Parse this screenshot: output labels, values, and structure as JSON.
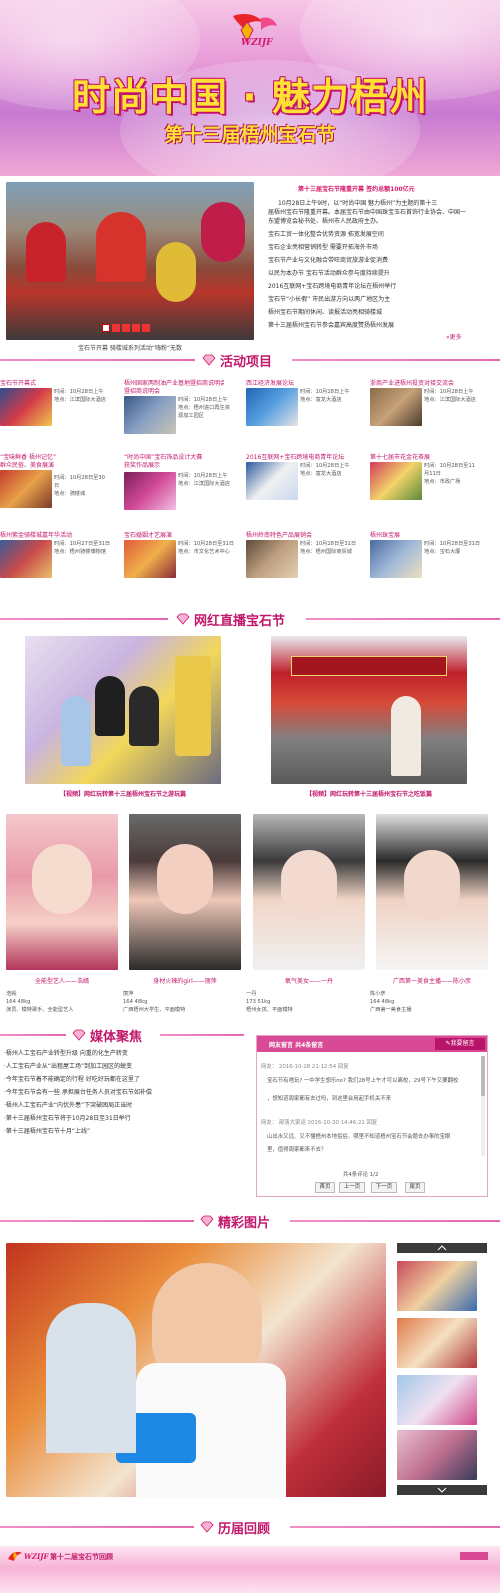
{
  "banner": {
    "logo_text": "WZIJF",
    "title": "时尚中国 · 魅力梧州",
    "subtitle": "第十三届梧州宝石节"
  },
  "top_news": {
    "photo_caption": "宝石节开幕 骑楼城系列活动“嗨粉”无数",
    "headline": "第十三届宝石节隆重开幕 签约总额100亿元",
    "summary": [
      "10月28日上午9时，以“时尚中国 魅力梧州”为主题的第十三",
      "届梧州宝石节隆重开幕。本届宝石节由中国珠宝玉石首饰行业协会、中国一",
      "东盟博览会秘书处、梧州市人民政府主办。"
    ],
    "list": [
      "宝石工贸一体化整合优势资源 拓宽发展空间",
      "宝石企业亮相营销转型 需要开拓海外市场",
      "宝石节产业与文化融合带旺商贸旅游业促消费",
      "以民为本办节 宝石节活动群众参与度持续提升",
      "2016互联网+宝石跨境电商青年论坛在梧州举行",
      "宝石节“小长假” 市民出游方向以两广地区为主",
      "梧州宝石节期间休闲、读报活动亮相骑楼城",
      "第十三届梧州宝石节参会嘉宾高度赞扬梧州发展"
    ],
    "more": "更多"
  },
  "sections": {
    "activities": "活动项目",
    "live": "网红直播宝石节",
    "media": "媒体聚焦",
    "photos": "精彩图片",
    "review": "历届回顾"
  },
  "activities": [
    {
      "title": "宝石节开幕式",
      "time": "时间：10月28日上午",
      "place": "地点：江滨国际大酒店"
    },
    {
      "title": "梧州国家两制油产业基地暨招商说明会",
      "time": "时间：10月28日上午",
      "place": "地点：梧州进口再生资源加工园区"
    },
    {
      "title": "西江经济发展论坛",
      "time": "时间：10月28日上午",
      "place": "地点：富龙大酒店"
    },
    {
      "title": "浙商产业进梧州投资对接交流会",
      "time": "时间：10月28日上午",
      "place": "地点：江滨国际大酒店"
    },
    {
      "title": "“宝味鲜香 梧州记忆”群众民俗、美食展演",
      "time": "时间：10月28日至30日",
      "place": "地点：骑楼城"
    },
    {
      "title": "“时尚中国”宝石饰品设计大赛获奖作品展示",
      "time": "时间：10月28日上午",
      "place": "地点：江滨国际大酒店"
    },
    {
      "title": "2016互联网+宝石跨境电商青年论坛",
      "time": "时间：10月28日上午",
      "place": "地点：富龙大酒店"
    },
    {
      "title": "第十七届市花金花茶展",
      "time": "时间：10月28日至11月11日",
      "place": "地点：市政广场"
    },
    {
      "title": "梧州紫金骑楼城嘉年华活动",
      "time": "时间：10月27日至31日",
      "place": "地点：梧州骑楼博物馆"
    },
    {
      "title": "宝石婚姻才艺展演",
      "time": "时间：10月28日至31日",
      "place": "地点：市文化艺术中心"
    },
    {
      "title": "梧州岭南特色产品展销会",
      "time": "时间：10月28日至31日",
      "place": "地点：梧州国际商贸城"
    },
    {
      "title": "梧州珠宝展",
      "time": "时间：10月28日至31日",
      "place": "地点：宝石大厦"
    }
  ],
  "live_videos": [
    {
      "caption": "【视频】网红玩转第十三届梧州宝石节之游玩篇"
    },
    {
      "caption": "【视频】网红玩转第十三届梧州宝石节之吃饭篇"
    }
  ],
  "anchors": [
    {
      "name": "全能型艺人——浩嫣",
      "l1": "浩嫣",
      "l2": "164  48kg",
      "l3": "演员、模特歌手、全能型艺人"
    },
    {
      "name": "身材火辣的girl——丽萍",
      "l1": "丽萍",
      "l2": "164  48kg",
      "l3": "广西梧州大学生、平面模特"
    },
    {
      "name": "氧气美女——一丹",
      "l1": "一丹",
      "l2": "173  51kg",
      "l3": "梧州女孩、平面模特"
    },
    {
      "name": "广西第一美食主播——陈小彦",
      "l1": "陈小彦",
      "l2": "164  48kg",
      "l3": "广西第一美食主播"
    }
  ],
  "media_news": [
    "·梧州人工宝石产业转型升级 向重的化生产转变",
    "·人工宝石产业从“出租屋工场”到加工园区的蜕变",
    "·今年宝石节着不能确定的行程 好吃好玩都在这里了",
    "·今年宝石节会有一些 承担展台任务人员对宝石节如补偿",
    "·梧州人工宝石产业“内忧外患”下突破困局正当时",
    "·第十三届梧州宝石节将于10月28日至31日举行",
    "·第十三届梧州宝石节十月“上线”"
  ],
  "messages": {
    "header": "网友留言 共4条留言",
    "button": "我要留言",
    "items": [
      {
        "meta": "网友： 2016-10-28 21:12:54 回复",
        "text1": "宝石节有啥玩? 一中学生想乐no? 我们28号上午才可以离校，29号下午又要翻校",
        "text2": "，想知道周家都有去过吗，到这里会用起手机关不来"
      },
      {
        "meta": "网友： 部落大家运 2016-10-30 14:46:21 回复",
        "text1": "山出水又远、又不懂梧州本地俗俗、哪里不知道梧州宝石节会题去办事的宝眼",
        "text2": "里，值得周家都来不去？"
      }
    ],
    "pagination": "共4条评论   1/2",
    "buttons": [
      "首页",
      "上一页",
      "下一页",
      "尾页"
    ]
  },
  "review": {
    "logo_text": "WZIJF",
    "title": "第十二届宝石节回顾"
  }
}
